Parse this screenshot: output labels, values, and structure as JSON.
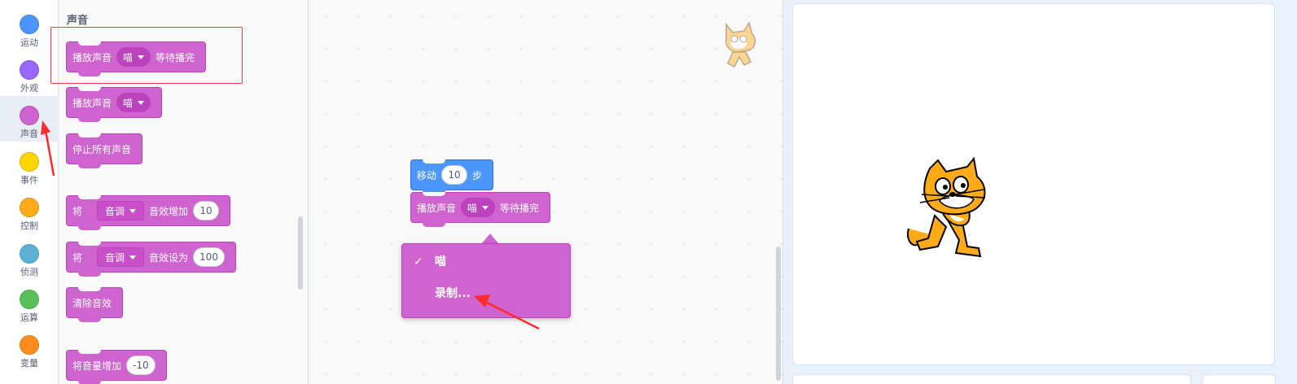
{
  "categories": [
    {
      "label": "运动",
      "color": "#4c97ff",
      "icon": "motion-category-icon"
    },
    {
      "label": "外观",
      "color": "#9966ff",
      "icon": "looks-category-icon"
    },
    {
      "label": "声音",
      "color": "#cf63cf",
      "icon": "sound-category-icon"
    },
    {
      "label": "事件",
      "color": "#ffd500",
      "icon": "events-category-icon"
    },
    {
      "label": "控制",
      "color": "#ffab19",
      "icon": "control-category-icon"
    },
    {
      "label": "侦测",
      "color": "#5cb1d6",
      "icon": "sensing-category-icon"
    },
    {
      "label": "运算",
      "color": "#59c059",
      "icon": "operators-category-icon"
    },
    {
      "label": "变量",
      "color": "#ff8c1a",
      "icon": "variables-category-icon"
    }
  ],
  "active_category": "声音",
  "palette": {
    "title": "声音",
    "play_until_done": {
      "label": "播放声音",
      "sound": "喵",
      "suffix": "等待播完"
    },
    "start_sound": {
      "label": "播放声音",
      "sound": "喵"
    },
    "stop_all": {
      "label": "停止所有声音"
    },
    "change_effect": {
      "prefix": "将",
      "effect": "音调",
      "action": "音效增加",
      "value": "10"
    },
    "set_effect": {
      "prefix": "将",
      "effect": "音调",
      "action": "音效设为",
      "value": "100"
    },
    "clear_effects": {
      "label": "清除音效"
    },
    "change_volume": {
      "label": "将音量增加",
      "value": "-10"
    }
  },
  "workspace": {
    "move_block": {
      "label": "移动",
      "value": "10",
      "suffix": "步"
    },
    "play_block": {
      "label": "播放声音",
      "sound": "喵",
      "suffix": "等待播完"
    },
    "dropdown_menu": {
      "items": [
        {
          "check": "✓",
          "label": "喵"
        },
        {
          "check": "",
          "label": "录制..."
        }
      ]
    }
  },
  "colors": {
    "sound": "#cf63cf",
    "motion": "#4c97ff",
    "annotation": "#ff3b3b"
  }
}
